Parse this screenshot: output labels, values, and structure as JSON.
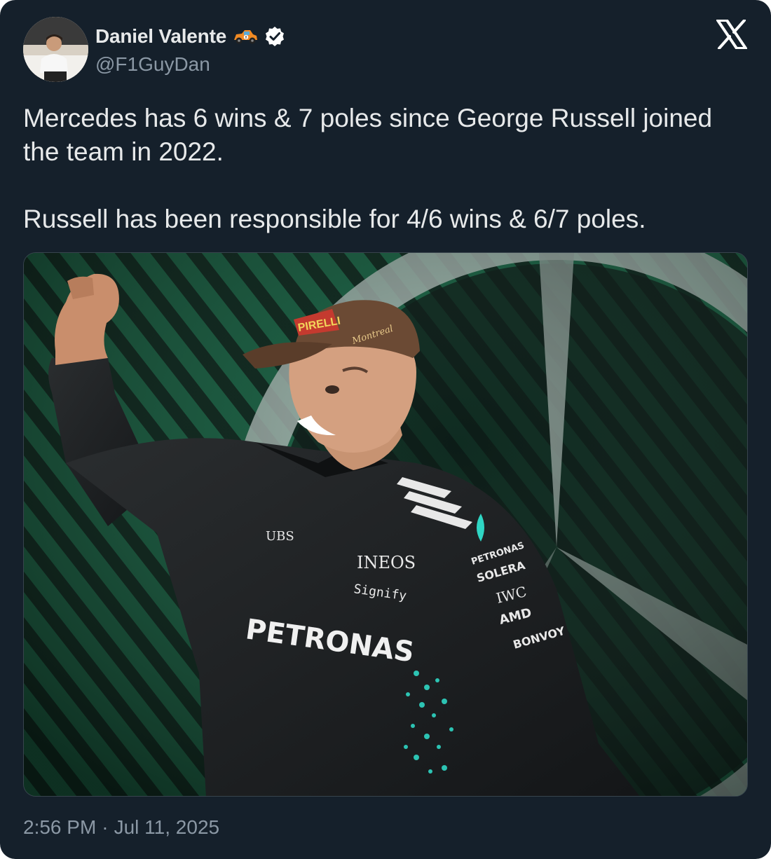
{
  "author": {
    "display_name": "Daniel Valente",
    "handle": "@F1GuyDan"
  },
  "icons": {
    "car_emoji": "race-car-emoji-icon",
    "verified": "verified-badge-icon",
    "platform": "x-logo-icon"
  },
  "tweet": {
    "line1": "Mercedes has 6 wins & 7 poles since George Russell joined the team in 2022.",
    "line2": "Russell has been responsible for 4/6 wins & 6/7 poles."
  },
  "media": {
    "cap_text": "PIRELLI",
    "cap_sub": "Montreal",
    "chest_sponsors": [
      "UBS",
      "INEOS",
      "Signify",
      "PETRONAS"
    ],
    "arm_sponsors": [
      "PETRONAS",
      "SOLERA",
      "IWC",
      "AMD",
      "BONVOY"
    ]
  },
  "meta": {
    "time": "2:56 PM",
    "separator": "·",
    "date": "Jul 11, 2025"
  },
  "colors": {
    "background": "#15202b",
    "text_primary": "#e7e9ea",
    "text_secondary": "#8b98a5",
    "verified": "#ffffff",
    "mercedes_teal": "#2fd6c4"
  }
}
